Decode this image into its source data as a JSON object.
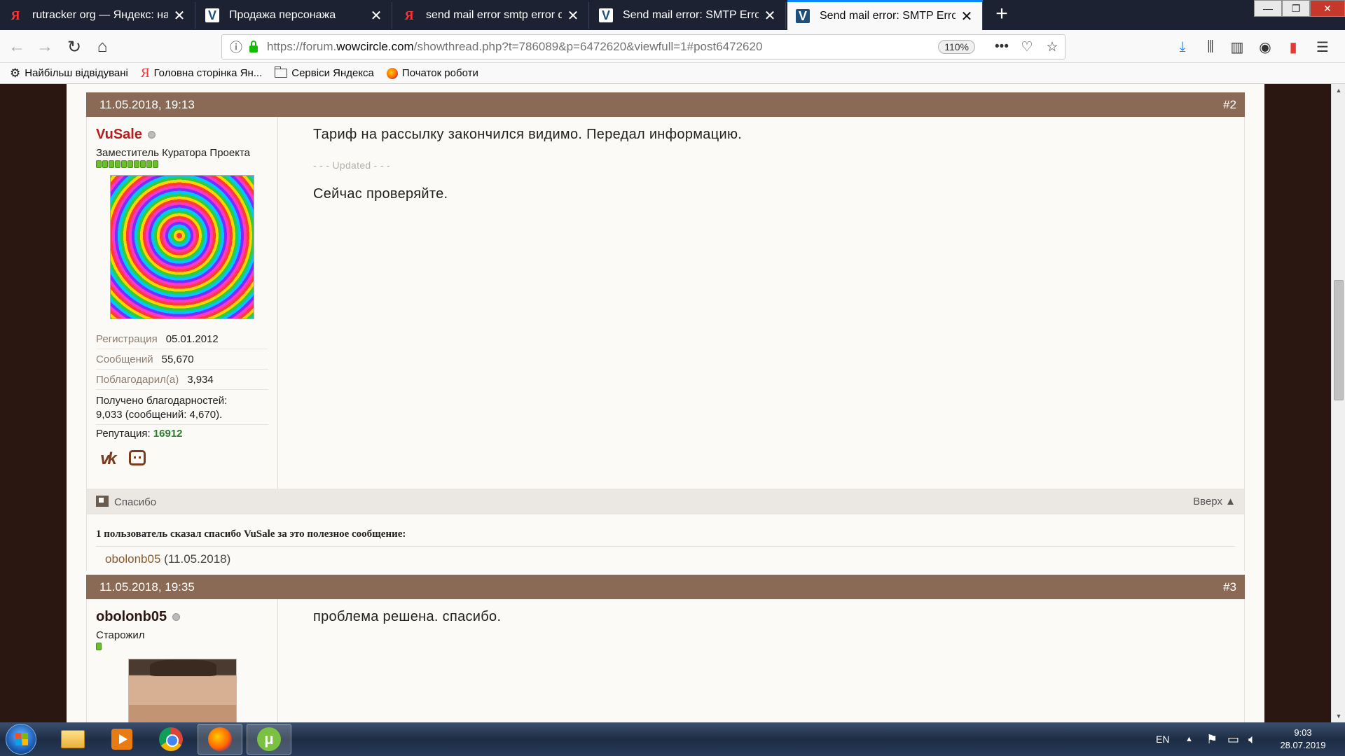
{
  "browser": {
    "tabs": [
      {
        "icon": "yandex-icon",
        "title": "rutracker org — Яндекс: нашлось",
        "active": false
      },
      {
        "icon": "wowcircle-icon",
        "title": "Продажа персонажа",
        "active": false
      },
      {
        "icon": "yandex-icon",
        "title": "send mail error smtp error data",
        "active": false
      },
      {
        "icon": "wowcircle-icon",
        "title": "Send mail error: SMTP Error: data",
        "active": false
      },
      {
        "icon": "wowcircle-icon",
        "title": "Send mail error: SMTP Error: data",
        "active": true
      }
    ],
    "url_prefix": "https://forum.",
    "url_domain": "wowcircle.com",
    "url_path": "/showthread.php?t=786089&p=6472620&viewfull=1#post6472620",
    "zoom": "110%",
    "bookmarks": [
      "Найбільш відвідувані",
      "Головна сторінка Ян...",
      "Сервіси Яндекса",
      "Початок роботи"
    ]
  },
  "posts": [
    {
      "date": "11.05.2018, 19:13",
      "number": "#2",
      "user": {
        "name": "VuSale",
        "title": "Заместитель Куратора Проекта",
        "reputation_pips": 10,
        "stats": [
          {
            "label": "Регистрация",
            "value": "05.01.2012"
          },
          {
            "label": "Сообщений",
            "value": "55,670"
          },
          {
            "label": "Поблагодарил(а)",
            "value": "3,934"
          }
        ],
        "thanks_received_label": "Получено благодарностей:",
        "thanks_received_value": "9,033 (сообщений: 4,670).",
        "reputation_label": "Репутация:",
        "reputation_value": "16912"
      },
      "text_1": "Тариф на рассылку закончился видимо. Передал информацию.",
      "updated_marker": "- - - Updated - - -",
      "text_2": "Сейчас проверяйте.",
      "footer_thanks": "Спасибо",
      "footer_top": "Вверх ▲",
      "thanks_title": "1 пользователь сказал спасибо VuSale за это полезное сообщение:",
      "thanks_user": "obolonb05",
      "thanks_date": "(11.05.2018)"
    },
    {
      "date": "11.05.2018, 19:35",
      "number": "#3",
      "user": {
        "name": "obolonb05",
        "title": "Старожил",
        "reputation_pips": 1
      },
      "text_1": "проблема решена. спасибо."
    }
  ],
  "taskbar": {
    "language": "EN",
    "time": "9:03",
    "date": "28.07.2019"
  },
  "colors": {
    "post_header": "#8a6a55",
    "username_red": "#b71c1c",
    "reputation_green": "#2e7d32",
    "page_bg": "#2b1712"
  }
}
